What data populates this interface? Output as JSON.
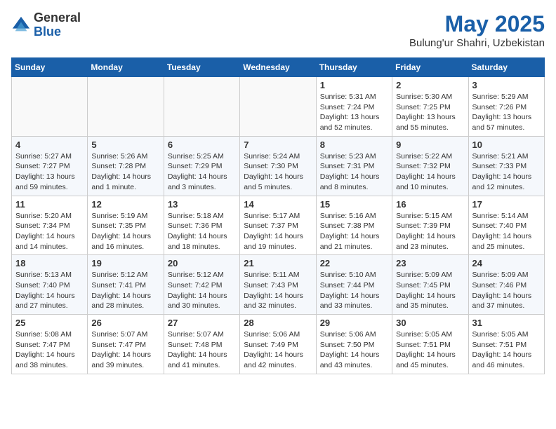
{
  "logo": {
    "general": "General",
    "blue": "Blue"
  },
  "header": {
    "title": "May 2025",
    "subtitle": "Bulung'ur Shahri, Uzbekistan"
  },
  "weekdays": [
    "Sunday",
    "Monday",
    "Tuesday",
    "Wednesday",
    "Thursday",
    "Friday",
    "Saturday"
  ],
  "weeks": [
    [
      {
        "day": "",
        "info": ""
      },
      {
        "day": "",
        "info": ""
      },
      {
        "day": "",
        "info": ""
      },
      {
        "day": "",
        "info": ""
      },
      {
        "day": "1",
        "info": "Sunrise: 5:31 AM\nSunset: 7:24 PM\nDaylight: 13 hours\nand 52 minutes."
      },
      {
        "day": "2",
        "info": "Sunrise: 5:30 AM\nSunset: 7:25 PM\nDaylight: 13 hours\nand 55 minutes."
      },
      {
        "day": "3",
        "info": "Sunrise: 5:29 AM\nSunset: 7:26 PM\nDaylight: 13 hours\nand 57 minutes."
      }
    ],
    [
      {
        "day": "4",
        "info": "Sunrise: 5:27 AM\nSunset: 7:27 PM\nDaylight: 13 hours\nand 59 minutes."
      },
      {
        "day": "5",
        "info": "Sunrise: 5:26 AM\nSunset: 7:28 PM\nDaylight: 14 hours\nand 1 minute."
      },
      {
        "day": "6",
        "info": "Sunrise: 5:25 AM\nSunset: 7:29 PM\nDaylight: 14 hours\nand 3 minutes."
      },
      {
        "day": "7",
        "info": "Sunrise: 5:24 AM\nSunset: 7:30 PM\nDaylight: 14 hours\nand 5 minutes."
      },
      {
        "day": "8",
        "info": "Sunrise: 5:23 AM\nSunset: 7:31 PM\nDaylight: 14 hours\nand 8 minutes."
      },
      {
        "day": "9",
        "info": "Sunrise: 5:22 AM\nSunset: 7:32 PM\nDaylight: 14 hours\nand 10 minutes."
      },
      {
        "day": "10",
        "info": "Sunrise: 5:21 AM\nSunset: 7:33 PM\nDaylight: 14 hours\nand 12 minutes."
      }
    ],
    [
      {
        "day": "11",
        "info": "Sunrise: 5:20 AM\nSunset: 7:34 PM\nDaylight: 14 hours\nand 14 minutes."
      },
      {
        "day": "12",
        "info": "Sunrise: 5:19 AM\nSunset: 7:35 PM\nDaylight: 14 hours\nand 16 minutes."
      },
      {
        "day": "13",
        "info": "Sunrise: 5:18 AM\nSunset: 7:36 PM\nDaylight: 14 hours\nand 18 minutes."
      },
      {
        "day": "14",
        "info": "Sunrise: 5:17 AM\nSunset: 7:37 PM\nDaylight: 14 hours\nand 19 minutes."
      },
      {
        "day": "15",
        "info": "Sunrise: 5:16 AM\nSunset: 7:38 PM\nDaylight: 14 hours\nand 21 minutes."
      },
      {
        "day": "16",
        "info": "Sunrise: 5:15 AM\nSunset: 7:39 PM\nDaylight: 14 hours\nand 23 minutes."
      },
      {
        "day": "17",
        "info": "Sunrise: 5:14 AM\nSunset: 7:40 PM\nDaylight: 14 hours\nand 25 minutes."
      }
    ],
    [
      {
        "day": "18",
        "info": "Sunrise: 5:13 AM\nSunset: 7:40 PM\nDaylight: 14 hours\nand 27 minutes."
      },
      {
        "day": "19",
        "info": "Sunrise: 5:12 AM\nSunset: 7:41 PM\nDaylight: 14 hours\nand 28 minutes."
      },
      {
        "day": "20",
        "info": "Sunrise: 5:12 AM\nSunset: 7:42 PM\nDaylight: 14 hours\nand 30 minutes."
      },
      {
        "day": "21",
        "info": "Sunrise: 5:11 AM\nSunset: 7:43 PM\nDaylight: 14 hours\nand 32 minutes."
      },
      {
        "day": "22",
        "info": "Sunrise: 5:10 AM\nSunset: 7:44 PM\nDaylight: 14 hours\nand 33 minutes."
      },
      {
        "day": "23",
        "info": "Sunrise: 5:09 AM\nSunset: 7:45 PM\nDaylight: 14 hours\nand 35 minutes."
      },
      {
        "day": "24",
        "info": "Sunrise: 5:09 AM\nSunset: 7:46 PM\nDaylight: 14 hours\nand 37 minutes."
      }
    ],
    [
      {
        "day": "25",
        "info": "Sunrise: 5:08 AM\nSunset: 7:47 PM\nDaylight: 14 hours\nand 38 minutes."
      },
      {
        "day": "26",
        "info": "Sunrise: 5:07 AM\nSunset: 7:47 PM\nDaylight: 14 hours\nand 39 minutes."
      },
      {
        "day": "27",
        "info": "Sunrise: 5:07 AM\nSunset: 7:48 PM\nDaylight: 14 hours\nand 41 minutes."
      },
      {
        "day": "28",
        "info": "Sunrise: 5:06 AM\nSunset: 7:49 PM\nDaylight: 14 hours\nand 42 minutes."
      },
      {
        "day": "29",
        "info": "Sunrise: 5:06 AM\nSunset: 7:50 PM\nDaylight: 14 hours\nand 43 minutes."
      },
      {
        "day": "30",
        "info": "Sunrise: 5:05 AM\nSunset: 7:51 PM\nDaylight: 14 hours\nand 45 minutes."
      },
      {
        "day": "31",
        "info": "Sunrise: 5:05 AM\nSunset: 7:51 PM\nDaylight: 14 hours\nand 46 minutes."
      }
    ]
  ]
}
